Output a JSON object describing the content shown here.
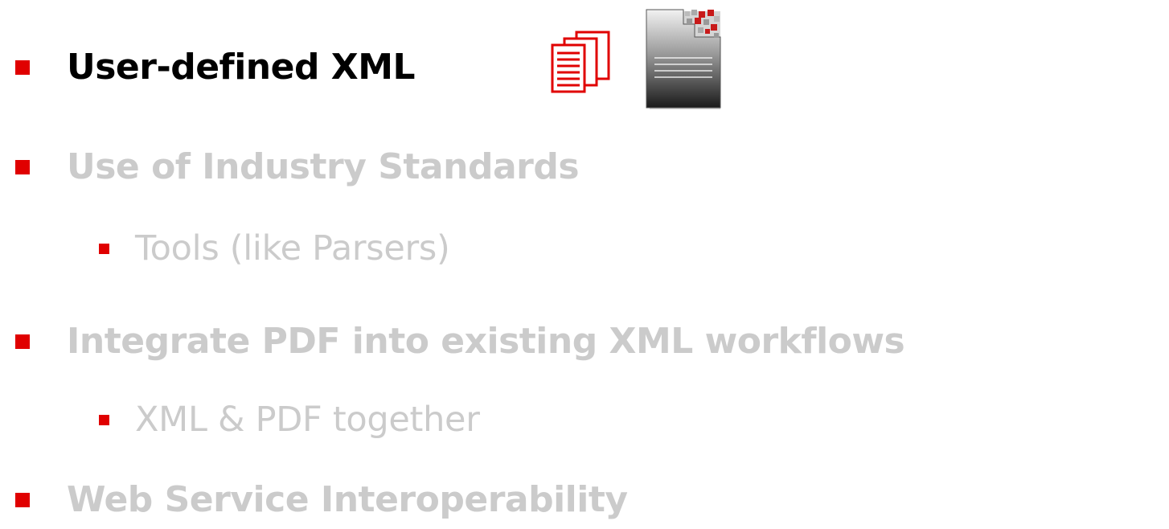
{
  "bullets": [
    {
      "text": "User-defined XML",
      "level": 1,
      "state": "active"
    },
    {
      "text": "Use of Industry Standards",
      "level": 1,
      "state": "dimmed"
    },
    {
      "text": "Tools (like Parsers)",
      "level": 2,
      "state": "dimmed"
    },
    {
      "text": "Integrate PDF into existing XML workflows",
      "level": 1,
      "state": "dimmed"
    },
    {
      "text": "XML & PDF together",
      "level": 2,
      "state": "dimmed"
    },
    {
      "text": "Web Service Interoperability",
      "level": 1,
      "state": "dimmed"
    }
  ],
  "icons": {
    "pages": "documents-stack-icon",
    "xml_doc": "xml-document-icon"
  },
  "colors": {
    "bullet": "#e00000",
    "active_text": "#000000",
    "dimmed_text": "#cbcbcb",
    "icon_red": "#e00000"
  }
}
